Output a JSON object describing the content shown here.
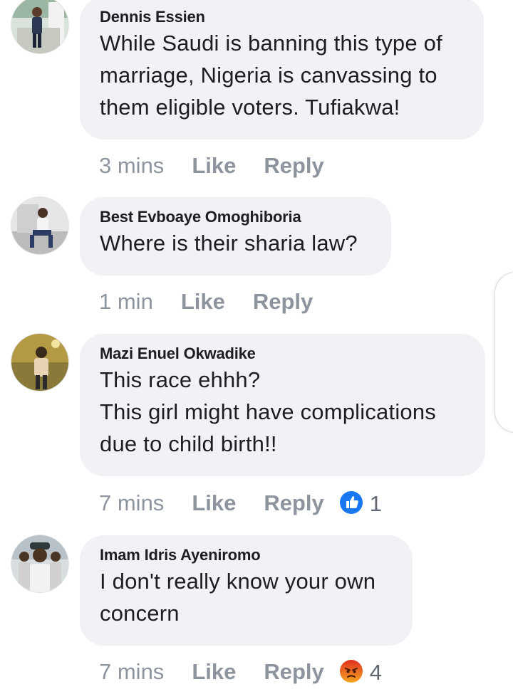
{
  "comments": [
    {
      "author": "Dennis Essien",
      "lines": [
        "While Saudi is banning this type of",
        "marriage, Nigeria is canvassing to",
        "them eligible voters. Tufiakwa!"
      ],
      "time": "3 mins",
      "like_label": "Like",
      "reply_label": "Reply"
    },
    {
      "author": "Best Evboaye Omoghiboria",
      "lines": [
        "Where is their sharia law?"
      ],
      "time": "1 min",
      "like_label": "Like",
      "reply_label": "Reply"
    },
    {
      "author": "Mazi Enuel Okwadike",
      "lines": [
        "This race ehhh?",
        "This girl might have complications",
        "due to child birth!!"
      ],
      "time": "7 mins",
      "like_label": "Like",
      "reply_label": "Reply",
      "reaction": {
        "icon": "like-icon",
        "color": "#1877f2",
        "count": "1"
      }
    },
    {
      "author": "Imam Idris Ayeniromo",
      "lines": [
        "I don't really know your own",
        "concern"
      ],
      "time": "7 mins",
      "like_label": "Like",
      "reply_label": "Reply",
      "reaction": {
        "icon": "angry-icon",
        "color": "#e9710f",
        "count": "4"
      }
    }
  ],
  "colors": {
    "bubble": "#f0f2f5",
    "text": "#1c1e21",
    "meta": "#8d949e",
    "like_blue": "#1877f2",
    "angry_orange": "#e9710f"
  }
}
